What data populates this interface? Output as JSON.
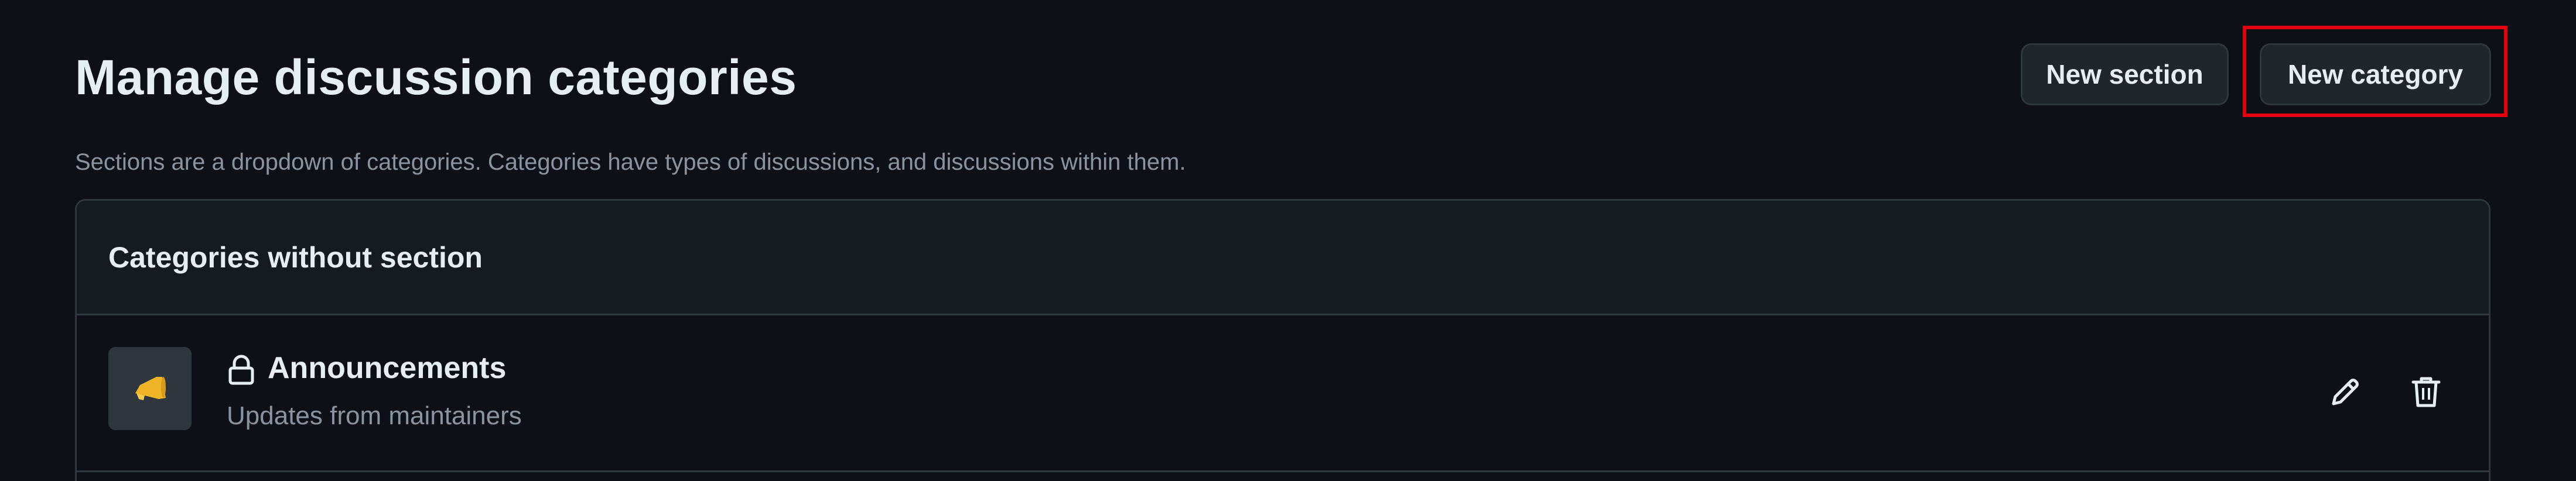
{
  "header": {
    "title": "Manage discussion categories",
    "subtitle": "Sections are a dropdown of categories. Categories have types of discussions, and discussions within them."
  },
  "actions": {
    "new_section_label": "New section",
    "new_category_label": "New category"
  },
  "panel": {
    "title": "Categories without section",
    "categories": [
      {
        "name": "Announcements",
        "description": "Updates from maintainers",
        "emoji": "megaphone-icon",
        "locked": true
      }
    ]
  },
  "colors": {
    "background": "#0d1117",
    "panel_header": "#161b22",
    "border": "#30363d",
    "button_bg": "#21262d",
    "text_primary": "#e6edf3",
    "text_muted": "#8b949e",
    "highlight": "#e3000f",
    "emoji_accent": "#f0b429"
  }
}
